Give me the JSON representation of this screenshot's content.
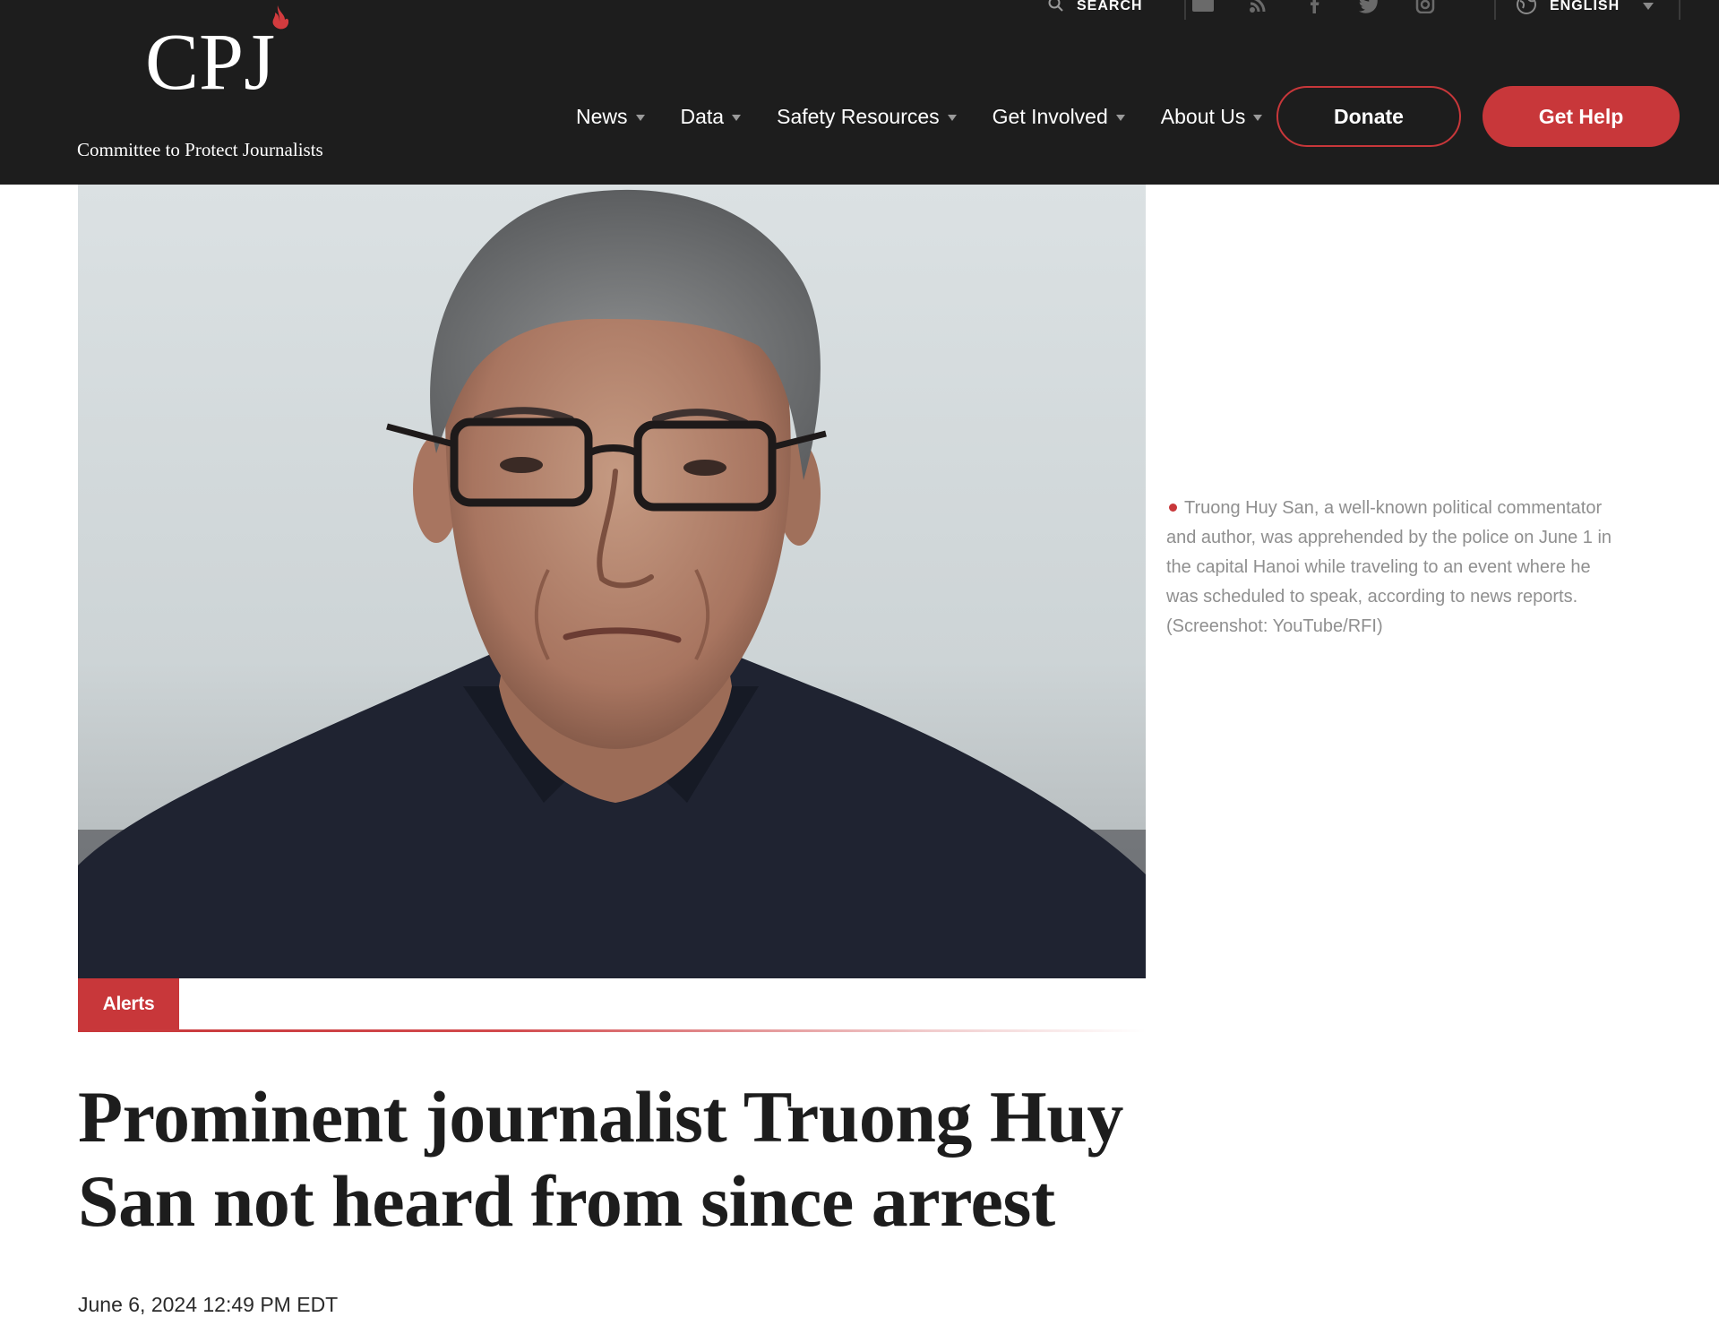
{
  "brand": {
    "logo_text": "CPJ",
    "tagline": "Committee to Protect Journalists"
  },
  "utility": {
    "search_label": "SEARCH",
    "language_label": "ENGLISH",
    "social_icons": [
      "email-icon",
      "rss-icon",
      "facebook-icon",
      "twitter-icon",
      "instagram-icon"
    ]
  },
  "nav": {
    "items": [
      {
        "label": "News"
      },
      {
        "label": "Data"
      },
      {
        "label": "Safety Resources"
      },
      {
        "label": "Get Involved"
      },
      {
        "label": "About Us"
      }
    ],
    "donate_label": "Donate",
    "help_label": "Get Help"
  },
  "hero": {
    "caption": "Truong Huy San, a well-known political commentator and author, was apprehended by the police on June 1 in the capital Hanoi while traveling to an event where he was scheduled to speak, according to news reports. (Screenshot: YouTube/RFI)"
  },
  "article": {
    "category": "Alerts",
    "headline": "Prominent journalist Truong Huy San not heard from since arrest",
    "date": "June 6, 2024 12:49 PM EDT"
  },
  "colors": {
    "header_bg": "#1d1d1d",
    "accent_red": "#c8373a",
    "caption_gray": "#8f8f8f"
  }
}
